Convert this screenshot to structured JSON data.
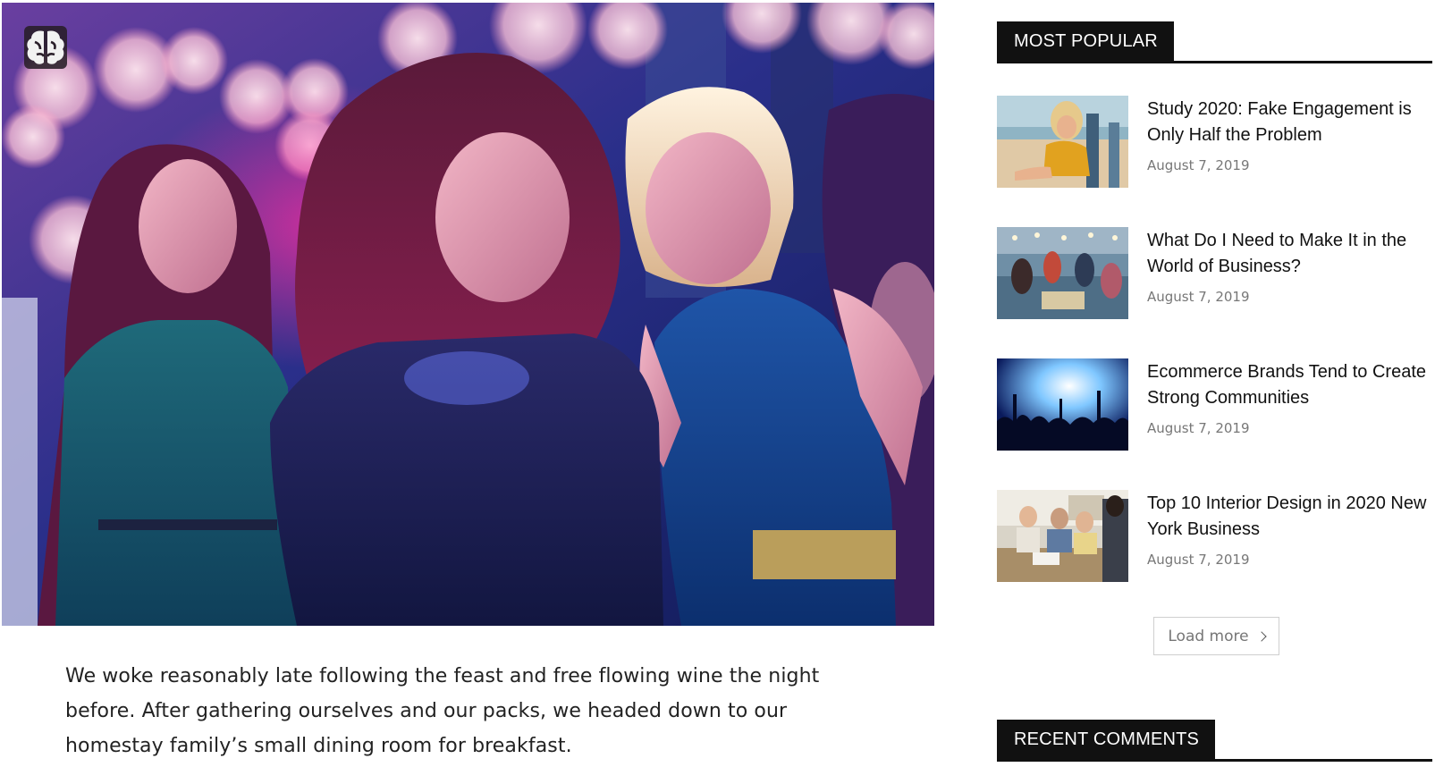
{
  "hero": {
    "image": "party-women-dancing-photo",
    "badge_icon": "brain-icon"
  },
  "article": {
    "paragraph": "We woke reasonably late following the feast and free flowing wine the night before. After gathering ourselves and our packs, we headed down to our homestay family’s small dining room for breakfast."
  },
  "sidebar": {
    "most_popular_title": "MOST POPULAR",
    "posts": [
      {
        "title": "Study 2020: Fake Engagement is Only Half the Problem",
        "date": "August 7, 2019",
        "thumb": "woman-beach-chair-photo"
      },
      {
        "title": "What Do I Need to Make It in the World of Business?",
        "date": "August 7, 2019",
        "thumb": "friends-beach-picnic-photo"
      },
      {
        "title": "Ecommerce Brands Tend to Create Strong Communities",
        "date": "August 7, 2019",
        "thumb": "concert-crowd-photo"
      },
      {
        "title": "Top 10 Interior Design in 2020 New York Business",
        "date": "August 7, 2019",
        "thumb": "office-meeting-photo"
      }
    ],
    "load_more_label": "Load more",
    "recent_comments_title": "RECENT COMMENTS"
  }
}
